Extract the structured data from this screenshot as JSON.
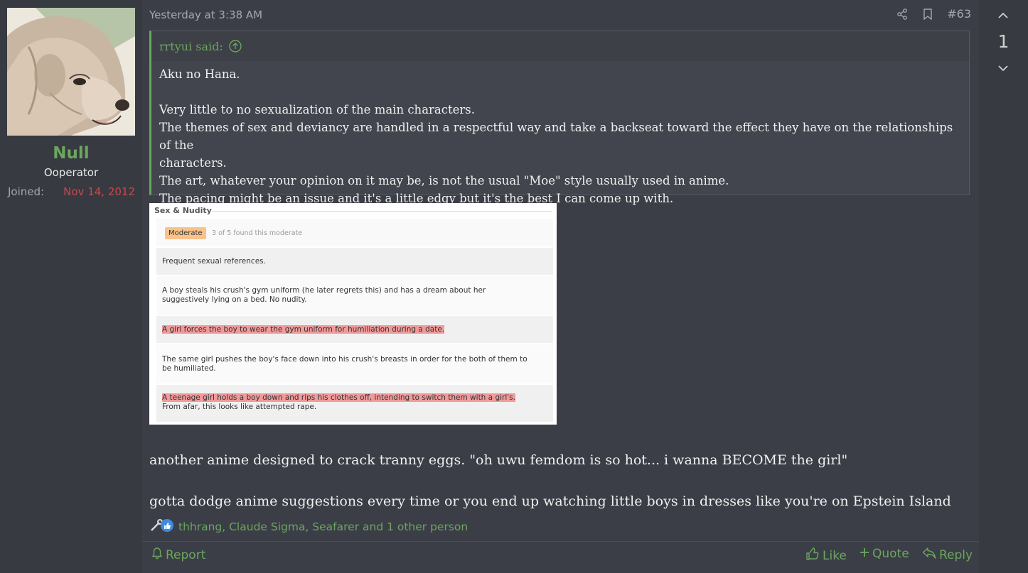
{
  "user": {
    "username": "Null",
    "title": "Ooperator",
    "joined_label": "Joined:",
    "joined_date": "Nov 14, 2012"
  },
  "post": {
    "date": "Yesterday at 3:38 AM",
    "number": "#63",
    "quote": {
      "author": "rrtyui said:",
      "lines": [
        "Aku no Hana.",
        "Very little to no sexualization of the main characters.",
        "The themes of sex and deviancy are handled in a respectful way and take a backseat toward the effect they have on the relationships of the",
        "characters.",
        "The art, whatever your opinion on it may be, is not the usual \"Moe\" style usually used in anime.",
        "The pacing might be an issue and it's a little edgy but it's the best I can come up with."
      ]
    },
    "image": {
      "title": "Sex & Nudity",
      "badge": "Moderate",
      "found": "3 of 5 found this moderate",
      "rows": [
        "Frequent sexual references.",
        "A boy steals his crush's gym uniform (he later regrets this) and has a dream about her",
        "suggestively lying on a bed. No nudity.",
        "A girl forces the boy to wear the gym uniform for humiliation during a date.",
        "The same girl pushes the boy's face down into his crush's breasts in order for the both of them to",
        "be humiliated.",
        "A teenage girl holds a boy down and rips his clothes off, intending to switch them with a girl's.",
        "From afar, this looks like attempted rape."
      ]
    },
    "body": [
      "another anime designed to crack tranny eggs. \"oh uwu femdom is so hot... i wanna BECOME the girl\"",
      "gotta dodge anime suggestions every time or you end up watching little boys in dresses like you're on Epstein Island"
    ],
    "reactions": "thhrang, Claude Sigma, Seafarer and 1 other person",
    "actions": {
      "report": "Report",
      "like": "Like",
      "quote": "Quote",
      "reply": "Reply"
    }
  },
  "rail": {
    "vote_count": "1"
  },
  "colors": {
    "accent_green": "#6ba65e",
    "joined_red": "#c9484a",
    "highlight": "#f19a9a",
    "badge_orange": "#f8c38a"
  },
  "icons": [
    "share-icon",
    "bookmark-icon",
    "arrow-up-circle-icon",
    "chevron-up-icon",
    "chevron-down-icon",
    "thumbs-up-icon",
    "plus-icon",
    "reply-icon",
    "bell-icon",
    "wrench-icon"
  ]
}
